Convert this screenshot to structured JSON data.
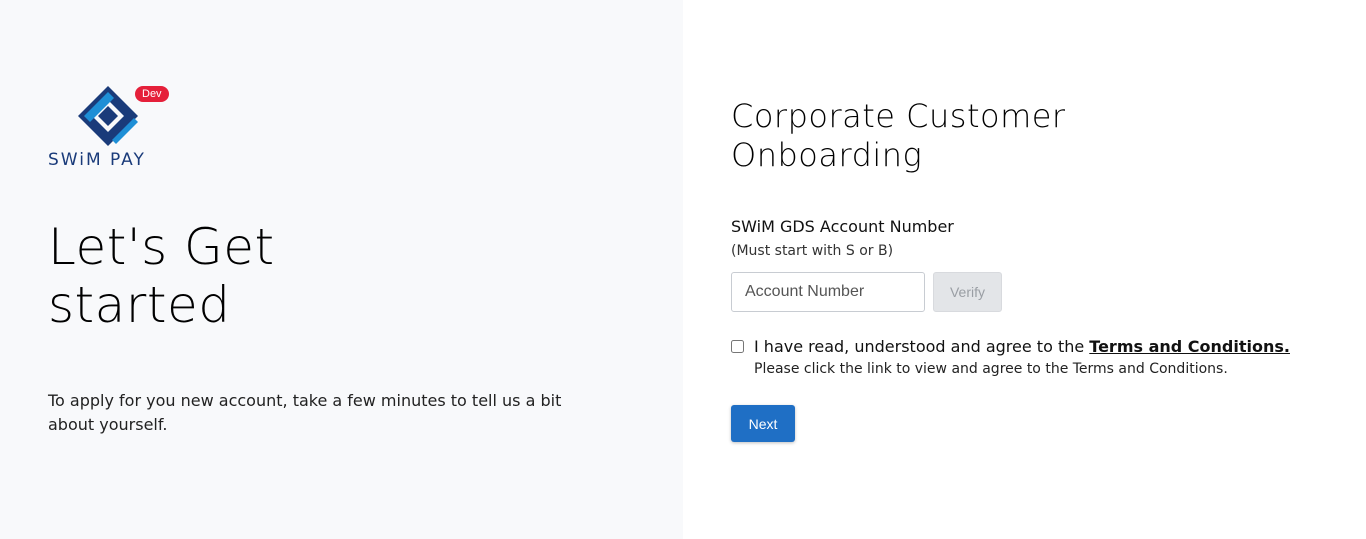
{
  "brand": {
    "name": "SWiM PAY",
    "env_badge": "Dev",
    "colors": {
      "primary": "#1a3b7a",
      "accent": "#1e8fd6",
      "badge": "#e5203a"
    }
  },
  "hero": {
    "title_line1": "Let's Get",
    "title_line2": "started",
    "subtitle": "To apply for you new account, take a few minutes to tell us a bit about yourself."
  },
  "form": {
    "title_line1": "Corporate Customer",
    "title_line2": "Onboarding",
    "account_label": "SWiM GDS Account Number",
    "account_hint": "(Must start with S or B)",
    "account_placeholder": "Account Number",
    "account_value": "",
    "verify_label": "Verify",
    "terms_prefix": "I have read, understood and agree to the ",
    "terms_link": "Terms and Conditions.",
    "terms_note": "Please click the link to view and agree to the Terms and Conditions.",
    "terms_checked": false,
    "next_label": "Next",
    "next_color": "#1f6fc5"
  }
}
